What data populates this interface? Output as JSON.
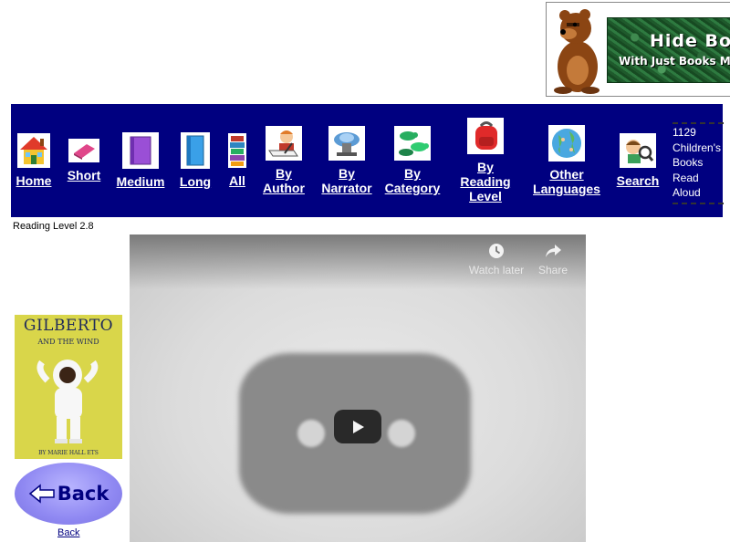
{
  "banner": {
    "title": "Hide Boo",
    "subtitle": "With Just Books M"
  },
  "nav": {
    "items": [
      {
        "label": "Home",
        "icon": "house-icon"
      },
      {
        "label": "Short",
        "icon": "pink-book-icon"
      },
      {
        "label": "Medium",
        "icon": "purple-book-icon"
      },
      {
        "label": "Long",
        "icon": "blue-book-icon"
      },
      {
        "label": "All",
        "icon": "book-stack-icon"
      },
      {
        "label": "By\nAuthor",
        "icon": "writer-icon"
      },
      {
        "label": "By\nNarrator",
        "icon": "narrator-icon"
      },
      {
        "label": "By\nCategory",
        "icon": "lizards-icon"
      },
      {
        "label": "By\nReading\nLevel",
        "icon": "backpack-icon"
      },
      {
        "label": "Other\nLanguages",
        "icon": "globe-icon"
      },
      {
        "label": "Search",
        "icon": "magnifier-kid-icon"
      }
    ],
    "book_count": {
      "number": "1129",
      "line1": "Children's",
      "line2": "Books",
      "line3": "Read",
      "line4": "Aloud"
    }
  },
  "reading_level": "Reading Level 2.8",
  "cover": {
    "title": "GILBERTO",
    "subtitle": "AND THE WIND",
    "author": "BY MARIE HALL ETS"
  },
  "back": {
    "button_label": "Back",
    "link_label": "Back"
  },
  "video": {
    "watch_later": "Watch later",
    "share": "Share"
  },
  "colors": {
    "nav_bg": "#000080",
    "back_button": "#8f88f2"
  }
}
